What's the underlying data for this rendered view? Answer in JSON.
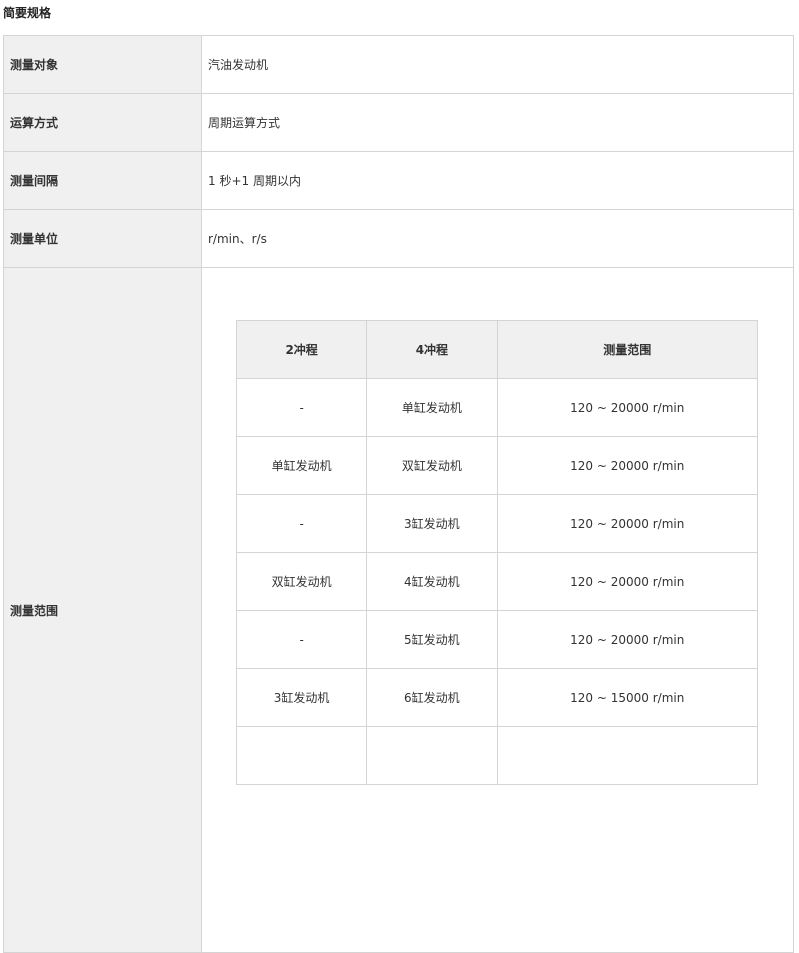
{
  "section_title": "简要规格",
  "specs": [
    {
      "label": "测量对象",
      "value": "汽油发动机"
    },
    {
      "label": "运算方式",
      "value": "周期运算方式"
    },
    {
      "label": "测量间隔",
      "value": "1 秒+1 周期以内"
    },
    {
      "label": "测量单位",
      "value": "r/min、r/s"
    }
  ],
  "range": {
    "label": "测量范围",
    "headers": [
      "2冲程",
      "4冲程",
      "测量范围"
    ],
    "rows": [
      [
        "-",
        "单缸发动机",
        "120 ~ 20000 r/min"
      ],
      [
        "单缸发动机",
        "双缸发动机",
        "120 ~ 20000 r/min"
      ],
      [
        "-",
        "3缸发动机",
        "120 ~ 20000 r/min"
      ],
      [
        "双缸发动机",
        "4缸发动机",
        "120 ~ 20000 r/min"
      ],
      [
        "-",
        "5缸发动机",
        "120 ~ 20000 r/min"
      ],
      [
        "3缸发动机",
        "6缸发动机",
        "120 ~ 15000 r/min"
      ],
      [
        "",
        "",
        ""
      ]
    ]
  }
}
